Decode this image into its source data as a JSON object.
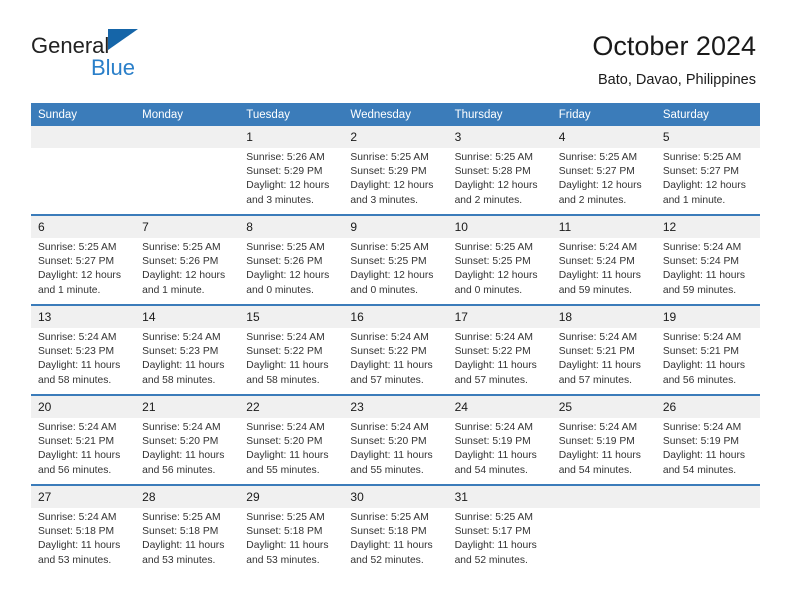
{
  "logo": {
    "line1": "General",
    "line2": "Blue",
    "triangle_color": "#1565a8",
    "blue_text_color": "#2a7fc9"
  },
  "header": {
    "title": "October 2024",
    "subtitle": "Bato, Davao, Philippines"
  },
  "theme": {
    "header_blue": "#3b7cba",
    "daynum_band": "#f0f0f0",
    "text": "#333333"
  },
  "weekdays": [
    "Sunday",
    "Monday",
    "Tuesday",
    "Wednesday",
    "Thursday",
    "Friday",
    "Saturday"
  ],
  "weeks": [
    [
      {
        "day": "",
        "sunrise": "",
        "sunset": "",
        "daylight1": "",
        "daylight2": ""
      },
      {
        "day": "",
        "sunrise": "",
        "sunset": "",
        "daylight1": "",
        "daylight2": ""
      },
      {
        "day": "1",
        "sunrise": "Sunrise: 5:26 AM",
        "sunset": "Sunset: 5:29 PM",
        "daylight1": "Daylight: 12 hours",
        "daylight2": "and 3 minutes."
      },
      {
        "day": "2",
        "sunrise": "Sunrise: 5:25 AM",
        "sunset": "Sunset: 5:29 PM",
        "daylight1": "Daylight: 12 hours",
        "daylight2": "and 3 minutes."
      },
      {
        "day": "3",
        "sunrise": "Sunrise: 5:25 AM",
        "sunset": "Sunset: 5:28 PM",
        "daylight1": "Daylight: 12 hours",
        "daylight2": "and 2 minutes."
      },
      {
        "day": "4",
        "sunrise": "Sunrise: 5:25 AM",
        "sunset": "Sunset: 5:27 PM",
        "daylight1": "Daylight: 12 hours",
        "daylight2": "and 2 minutes."
      },
      {
        "day": "5",
        "sunrise": "Sunrise: 5:25 AM",
        "sunset": "Sunset: 5:27 PM",
        "daylight1": "Daylight: 12 hours",
        "daylight2": "and 1 minute."
      }
    ],
    [
      {
        "day": "6",
        "sunrise": "Sunrise: 5:25 AM",
        "sunset": "Sunset: 5:27 PM",
        "daylight1": "Daylight: 12 hours",
        "daylight2": "and 1 minute."
      },
      {
        "day": "7",
        "sunrise": "Sunrise: 5:25 AM",
        "sunset": "Sunset: 5:26 PM",
        "daylight1": "Daylight: 12 hours",
        "daylight2": "and 1 minute."
      },
      {
        "day": "8",
        "sunrise": "Sunrise: 5:25 AM",
        "sunset": "Sunset: 5:26 PM",
        "daylight1": "Daylight: 12 hours",
        "daylight2": "and 0 minutes."
      },
      {
        "day": "9",
        "sunrise": "Sunrise: 5:25 AM",
        "sunset": "Sunset: 5:25 PM",
        "daylight1": "Daylight: 12 hours",
        "daylight2": "and 0 minutes."
      },
      {
        "day": "10",
        "sunrise": "Sunrise: 5:25 AM",
        "sunset": "Sunset: 5:25 PM",
        "daylight1": "Daylight: 12 hours",
        "daylight2": "and 0 minutes."
      },
      {
        "day": "11",
        "sunrise": "Sunrise: 5:24 AM",
        "sunset": "Sunset: 5:24 PM",
        "daylight1": "Daylight: 11 hours",
        "daylight2": "and 59 minutes."
      },
      {
        "day": "12",
        "sunrise": "Sunrise: 5:24 AM",
        "sunset": "Sunset: 5:24 PM",
        "daylight1": "Daylight: 11 hours",
        "daylight2": "and 59 minutes."
      }
    ],
    [
      {
        "day": "13",
        "sunrise": "Sunrise: 5:24 AM",
        "sunset": "Sunset: 5:23 PM",
        "daylight1": "Daylight: 11 hours",
        "daylight2": "and 58 minutes."
      },
      {
        "day": "14",
        "sunrise": "Sunrise: 5:24 AM",
        "sunset": "Sunset: 5:23 PM",
        "daylight1": "Daylight: 11 hours",
        "daylight2": "and 58 minutes."
      },
      {
        "day": "15",
        "sunrise": "Sunrise: 5:24 AM",
        "sunset": "Sunset: 5:22 PM",
        "daylight1": "Daylight: 11 hours",
        "daylight2": "and 58 minutes."
      },
      {
        "day": "16",
        "sunrise": "Sunrise: 5:24 AM",
        "sunset": "Sunset: 5:22 PM",
        "daylight1": "Daylight: 11 hours",
        "daylight2": "and 57 minutes."
      },
      {
        "day": "17",
        "sunrise": "Sunrise: 5:24 AM",
        "sunset": "Sunset: 5:22 PM",
        "daylight1": "Daylight: 11 hours",
        "daylight2": "and 57 minutes."
      },
      {
        "day": "18",
        "sunrise": "Sunrise: 5:24 AM",
        "sunset": "Sunset: 5:21 PM",
        "daylight1": "Daylight: 11 hours",
        "daylight2": "and 57 minutes."
      },
      {
        "day": "19",
        "sunrise": "Sunrise: 5:24 AM",
        "sunset": "Sunset: 5:21 PM",
        "daylight1": "Daylight: 11 hours",
        "daylight2": "and 56 minutes."
      }
    ],
    [
      {
        "day": "20",
        "sunrise": "Sunrise: 5:24 AM",
        "sunset": "Sunset: 5:21 PM",
        "daylight1": "Daylight: 11 hours",
        "daylight2": "and 56 minutes."
      },
      {
        "day": "21",
        "sunrise": "Sunrise: 5:24 AM",
        "sunset": "Sunset: 5:20 PM",
        "daylight1": "Daylight: 11 hours",
        "daylight2": "and 56 minutes."
      },
      {
        "day": "22",
        "sunrise": "Sunrise: 5:24 AM",
        "sunset": "Sunset: 5:20 PM",
        "daylight1": "Daylight: 11 hours",
        "daylight2": "and 55 minutes."
      },
      {
        "day": "23",
        "sunrise": "Sunrise: 5:24 AM",
        "sunset": "Sunset: 5:20 PM",
        "daylight1": "Daylight: 11 hours",
        "daylight2": "and 55 minutes."
      },
      {
        "day": "24",
        "sunrise": "Sunrise: 5:24 AM",
        "sunset": "Sunset: 5:19 PM",
        "daylight1": "Daylight: 11 hours",
        "daylight2": "and 54 minutes."
      },
      {
        "day": "25",
        "sunrise": "Sunrise: 5:24 AM",
        "sunset": "Sunset: 5:19 PM",
        "daylight1": "Daylight: 11 hours",
        "daylight2": "and 54 minutes."
      },
      {
        "day": "26",
        "sunrise": "Sunrise: 5:24 AM",
        "sunset": "Sunset: 5:19 PM",
        "daylight1": "Daylight: 11 hours",
        "daylight2": "and 54 minutes."
      }
    ],
    [
      {
        "day": "27",
        "sunrise": "Sunrise: 5:24 AM",
        "sunset": "Sunset: 5:18 PM",
        "daylight1": "Daylight: 11 hours",
        "daylight2": "and 53 minutes."
      },
      {
        "day": "28",
        "sunrise": "Sunrise: 5:25 AM",
        "sunset": "Sunset: 5:18 PM",
        "daylight1": "Daylight: 11 hours",
        "daylight2": "and 53 minutes."
      },
      {
        "day": "29",
        "sunrise": "Sunrise: 5:25 AM",
        "sunset": "Sunset: 5:18 PM",
        "daylight1": "Daylight: 11 hours",
        "daylight2": "and 53 minutes."
      },
      {
        "day": "30",
        "sunrise": "Sunrise: 5:25 AM",
        "sunset": "Sunset: 5:18 PM",
        "daylight1": "Daylight: 11 hours",
        "daylight2": "and 52 minutes."
      },
      {
        "day": "31",
        "sunrise": "Sunrise: 5:25 AM",
        "sunset": "Sunset: 5:17 PM",
        "daylight1": "Daylight: 11 hours",
        "daylight2": "and 52 minutes."
      },
      {
        "day": "",
        "sunrise": "",
        "sunset": "",
        "daylight1": "",
        "daylight2": ""
      },
      {
        "day": "",
        "sunrise": "",
        "sunset": "",
        "daylight1": "",
        "daylight2": ""
      }
    ]
  ]
}
